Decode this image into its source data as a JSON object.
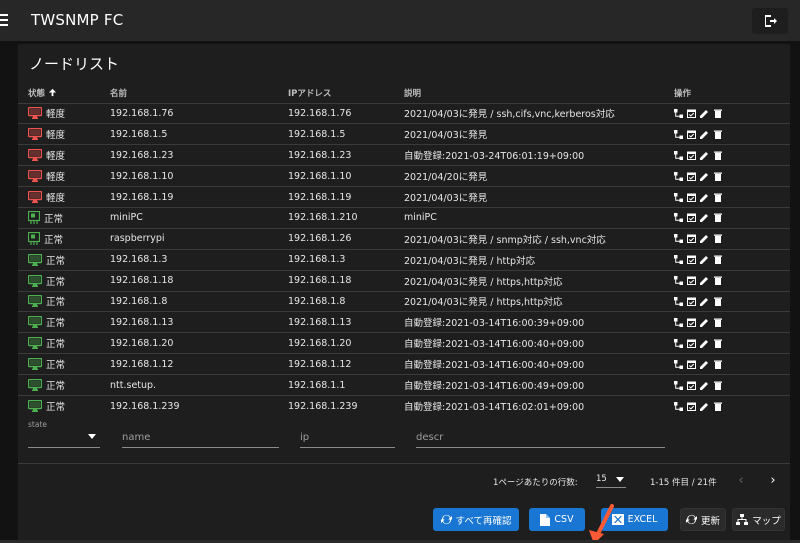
{
  "app": {
    "title": "TWSNMP FC"
  },
  "card": {
    "title": "ノードリスト"
  },
  "table": {
    "headers": [
      "状態",
      "名前",
      "IPアドレス",
      "説明",
      "操作"
    ],
    "rows": [
      {
        "state": "軽度",
        "state_color": "#ef5350",
        "icon": "monitor",
        "name": "192.168.1.76",
        "ip": "192.168.1.76",
        "descr": "2021/04/03に発見 / ssh,cifs,vnc,kerberos対応"
      },
      {
        "state": "軽度",
        "state_color": "#ef5350",
        "icon": "monitor",
        "name": "192.168.1.5",
        "ip": "192.168.1.5",
        "descr": "2021/04/03に発見"
      },
      {
        "state": "軽度",
        "state_color": "#ef5350",
        "icon": "monitor",
        "name": "192.168.1.23",
        "ip": "192.168.1.23",
        "descr": "自動登録:2021-03-24T06:01:19+09:00"
      },
      {
        "state": "軽度",
        "state_color": "#ef5350",
        "icon": "monitor",
        "name": "192.168.1.10",
        "ip": "192.168.1.10",
        "descr": "2021/04/20に発見"
      },
      {
        "state": "軽度",
        "state_color": "#ef5350",
        "icon": "monitor",
        "name": "192.168.1.19",
        "ip": "192.168.1.19",
        "descr": "2021/04/03に発見"
      },
      {
        "state": "正常",
        "state_color": "#4caf50",
        "icon": "board",
        "name": "miniPC",
        "ip": "192.168.1.210",
        "descr": "miniPC"
      },
      {
        "state": "正常",
        "state_color": "#4caf50",
        "icon": "board",
        "name": "raspberrypi",
        "ip": "192.168.1.26",
        "descr": "2021/04/03に発見 / snmp対応 / ssh,vnc対応"
      },
      {
        "state": "正常",
        "state_color": "#4caf50",
        "icon": "monitor",
        "name": "192.168.1.3",
        "ip": "192.168.1.3",
        "descr": "2021/04/03に発見 / http対応"
      },
      {
        "state": "正常",
        "state_color": "#4caf50",
        "icon": "monitor",
        "name": "192.168.1.18",
        "ip": "192.168.1.18",
        "descr": "2021/04/03に発見 / https,http対応"
      },
      {
        "state": "正常",
        "state_color": "#4caf50",
        "icon": "monitor",
        "name": "192.168.1.8",
        "ip": "192.168.1.8",
        "descr": "2021/04/03に発見 / https,http対応"
      },
      {
        "state": "正常",
        "state_color": "#4caf50",
        "icon": "monitor",
        "name": "192.168.1.13",
        "ip": "192.168.1.13",
        "descr": "自動登録:2021-03-14T16:00:39+09:00"
      },
      {
        "state": "正常",
        "state_color": "#4caf50",
        "icon": "monitor",
        "name": "192.168.1.20",
        "ip": "192.168.1.20",
        "descr": "自動登録:2021-03-14T16:00:40+09:00"
      },
      {
        "state": "正常",
        "state_color": "#4caf50",
        "icon": "monitor",
        "name": "192.168.1.12",
        "ip": "192.168.1.12",
        "descr": "自動登録:2021-03-14T16:00:40+09:00"
      },
      {
        "state": "正常",
        "state_color": "#4caf50",
        "icon": "monitor",
        "name": "ntt.setup.",
        "ip": "192.168.1.1",
        "descr": "自動登録:2021-03-14T16:00:49+09:00"
      },
      {
        "state": "正常",
        "state_color": "#4caf50",
        "icon": "monitor",
        "name": "192.168.1.239",
        "ip": "192.168.1.239",
        "descr": "自動登録:2021-03-14T16:02:01+09:00"
      }
    ]
  },
  "filters": {
    "state_label": "state",
    "name_placeholder": "name",
    "ip_placeholder": "ip",
    "descr_placeholder": "descr"
  },
  "pagination": {
    "rows_per_page_label": "1ページあたりの行数:",
    "rows_per_page_value": "15",
    "range_text": "1-15 件目 / 21件"
  },
  "actions": {
    "recheck_all": "すべて再確認",
    "csv": "CSV",
    "excel": "EXCEL",
    "refresh": "更新",
    "map": "マップ"
  },
  "colors": {
    "accent": "#1976d2",
    "warning": "#ef5350",
    "normal": "#4caf50",
    "annotation_arrow": "#ff5a36"
  }
}
